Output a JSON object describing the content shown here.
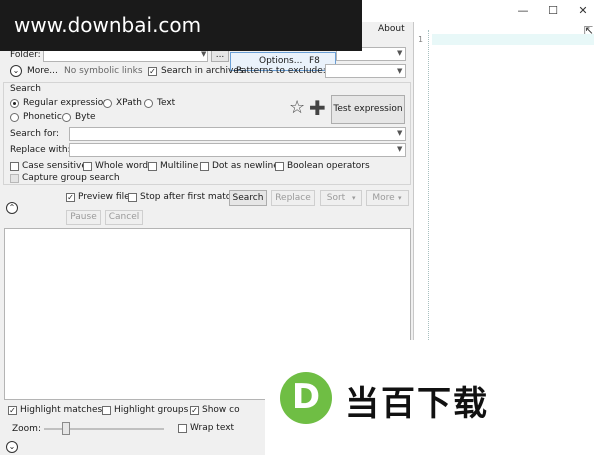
{
  "watermark": "www.downbai.com",
  "window": {
    "minimize": "—",
    "maximize": "☐",
    "close": "✕"
  },
  "menu": {
    "about": "About"
  },
  "popup": {
    "options_label": "Options...",
    "options_key": "F8"
  },
  "folder": {
    "label": "Folder:",
    "value": "",
    "browse": "..."
  },
  "more": {
    "label": "More...",
    "no_symbolic_links": "No symbolic links",
    "search_in_archives": "Search in archives",
    "patterns_label": "Patterns to exclude:"
  },
  "search": {
    "section": "Search",
    "modes": [
      "Regular expression",
      "XPath",
      "Text",
      "Phonetic",
      "Byte"
    ],
    "test_button": "Test expression",
    "search_for_label": "Search for:",
    "replace_with_label": "Replace with:"
  },
  "options": {
    "case_sensitive": "Case sensitive",
    "whole_word": "Whole word",
    "multiline": "Multiline",
    "dot_newline": "Dot as newline",
    "boolean_ops": "Boolean operators",
    "capture_group": "Capture group search"
  },
  "actions": {
    "preview_file": "Preview file",
    "stop_first": "Stop after first match",
    "search": "Search",
    "replace": "Replace",
    "sort": "Sort",
    "more": "More",
    "pause": "Pause",
    "cancel": "Cancel"
  },
  "bottom": {
    "highlight_matches": "Highlight matches",
    "highlight_groups": "Highlight groups",
    "show_context": "Show co",
    "zoom_label": "Zoom:",
    "wrap_text": "Wrap text"
  },
  "editor": {
    "line_number": "1"
  },
  "logo": {
    "letter": "D",
    "text": "当百下载"
  }
}
